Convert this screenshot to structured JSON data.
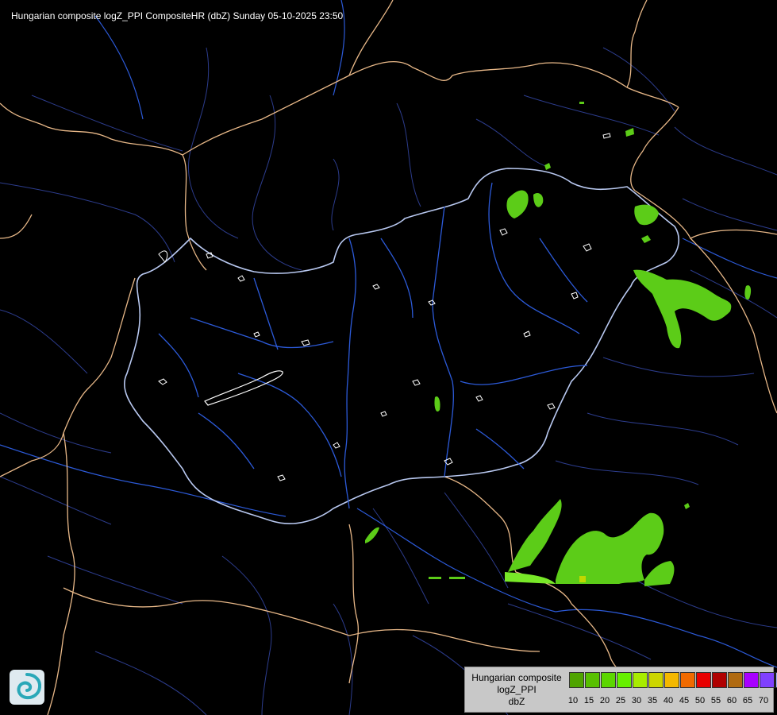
{
  "title": "Hungarian composite logZ_PPI CompositeHR (dbZ) Sunday 05-10-2025 23:50",
  "legend": {
    "lines": [
      "Hungarian composite",
      "logZ_PPI",
      "dbZ"
    ],
    "swatch_colors": [
      "#4fa400",
      "#58c000",
      "#5cd600",
      "#66f000",
      "#a8ec00",
      "#ccd600",
      "#f4b800",
      "#f06a00",
      "#e80000",
      "#b00000",
      "#b06a10",
      "#a800ff",
      "#8040ff",
      "#a8b4ff"
    ],
    "tick_labels": [
      "10",
      "15",
      "20",
      "25",
      "30",
      "35",
      "40",
      "45",
      "50",
      "55",
      "60",
      "65",
      "70"
    ]
  },
  "colors": {
    "country_border": "#e8b888",
    "hu_border": "#b8c8f0",
    "rivers": "#2c5ad8",
    "county_lines": "#2c3c8c",
    "lakes": "#ffffff",
    "echo_light": "#5ccc18",
    "echo_medium": "#78e828",
    "echo_strong": "#c0d800"
  },
  "logo_icon": "swirl-logo-icon"
}
